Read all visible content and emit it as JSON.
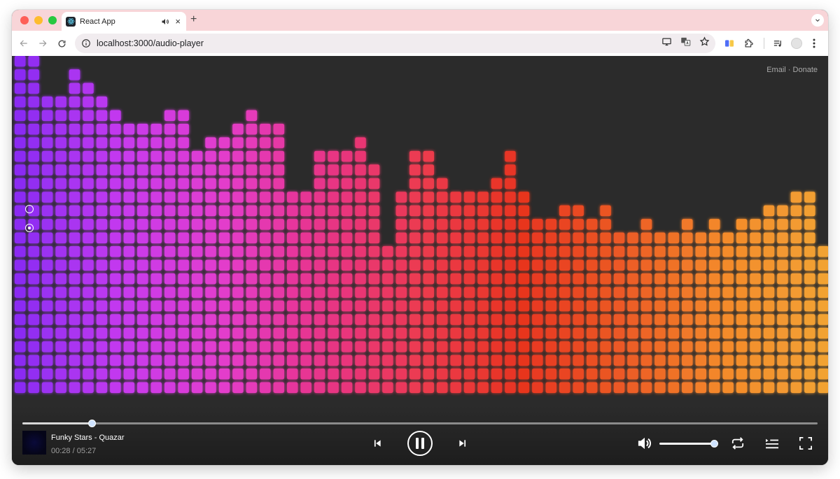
{
  "browser": {
    "tab_title": "React App",
    "new_tab": "+",
    "close": "×",
    "url": "localhost:3000/audio-player"
  },
  "page": {
    "links": {
      "email": "Email",
      "separator": "·",
      "donate": "Donate"
    }
  },
  "visualizer": {
    "columns": 60,
    "rows": 25,
    "levels": [
      25,
      25,
      22,
      22,
      24,
      23,
      22,
      21,
      20,
      20,
      20,
      21,
      21,
      18,
      19,
      19,
      20,
      21,
      20,
      20,
      15,
      15,
      18,
      18,
      18,
      19,
      17,
      11,
      15,
      18,
      18,
      16,
      15,
      15,
      15,
      16,
      18,
      15,
      13,
      13,
      14,
      14,
      13,
      14,
      12,
      12,
      13,
      12,
      12,
      13,
      12,
      13,
      12,
      13,
      13,
      14,
      14,
      15,
      15,
      11
    ],
    "colors": [
      "#8b2cf3",
      "#c53aef",
      "#e33ccd",
      "#e8348a",
      "#ec3a4f",
      "#e8351f",
      "#ec5a25",
      "#f48a2b",
      "#f2a233"
    ],
    "radios": [
      {
        "checked": false
      },
      {
        "checked": true
      }
    ]
  },
  "player": {
    "track": "Funky Stars - Quazar",
    "current_time": "00:28",
    "separator": " / ",
    "duration": "05:27",
    "progress": 0.087,
    "volume": 1.0
  }
}
